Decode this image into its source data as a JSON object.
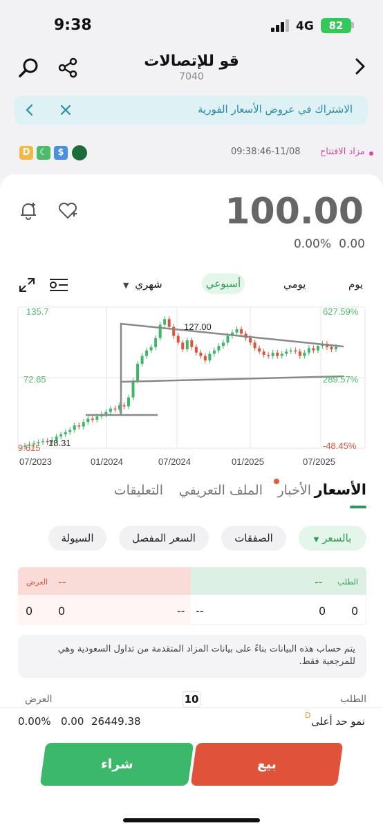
{
  "status_bar": {
    "time": "9:38",
    "network": "4G",
    "battery": "82"
  },
  "header": {
    "title": "قو للإتصالات",
    "code": "7040"
  },
  "banner": {
    "text": "الاشتراك في عروض الأسعار الفورية"
  },
  "market": {
    "status": "مزاد الافتتاح",
    "timestamp": "09:38:46-11/08",
    "badges": [
      "D",
      "☾",
      "$"
    ]
  },
  "quote": {
    "price": "100.00",
    "change": "0.00",
    "change_pct": "0.00%"
  },
  "timeframes": {
    "day": "يوم",
    "daily": "يومي",
    "weekly": "أسبوعي",
    "monthly": "شهري"
  },
  "chart_data": {
    "type": "candlestick",
    "y_left_labels": [
      "135.7",
      "72.65",
      "9.615"
    ],
    "y_right_labels": [
      "627.59%",
      "289.57%",
      "-48.45%"
    ],
    "x_labels": [
      "07/2023",
      "01/2024",
      "07/2024",
      "01/2025",
      "07/2025"
    ],
    "annotations": [
      "127.00",
      "18.31"
    ],
    "ylim": [
      9.615,
      135.7
    ],
    "grid": true,
    "closes": [
      12,
      13,
      14,
      15,
      16,
      15,
      17,
      20,
      22,
      24,
      26,
      30,
      29,
      33,
      36,
      35,
      38,
      40,
      42,
      45,
      44,
      48,
      47,
      55,
      70,
      85,
      92,
      97,
      100,
      108,
      120,
      125,
      118,
      110,
      104,
      98,
      106,
      100,
      95,
      92,
      88,
      94,
      97,
      101,
      104,
      110,
      113,
      116,
      112,
      108,
      104,
      99,
      96,
      93,
      92,
      95,
      92,
      94,
      96,
      97,
      96,
      92,
      95,
      99,
      97,
      101,
      103,
      100,
      98,
      100
    ]
  },
  "tabs": {
    "prices": "الأسعار",
    "news": "الأخبار",
    "profile": "الملف التعريفي",
    "comments": "التعليقات"
  },
  "chips": {
    "price": "بالسعر",
    "trades": "الصفقات",
    "detailed": "السعر المفصل",
    "liquidity": "السيولة"
  },
  "orderbook": {
    "bid_label": "الطلب",
    "ask_label": "العرض",
    "dash": "--",
    "bid_count": "0",
    "bid_qty": "0",
    "bid_price": "--",
    "ask_price": "--",
    "ask_qty": "0",
    "ask_count": "0"
  },
  "note": "يتم حساب هذه البيانات بناءً على بيانات المزاد المتقدمة من تداول السعودية وهي للمرجعية فقط.",
  "depth": {
    "bid_label": "الطلب",
    "ask_label": "العرض",
    "levels": "10"
  },
  "limit": {
    "label": "نمو حد أعلى",
    "badge": "D",
    "value": "26449.38",
    "change": "0.00",
    "pct": "0.00%"
  },
  "actions": {
    "buy": "شراء",
    "sell": "بيع"
  }
}
